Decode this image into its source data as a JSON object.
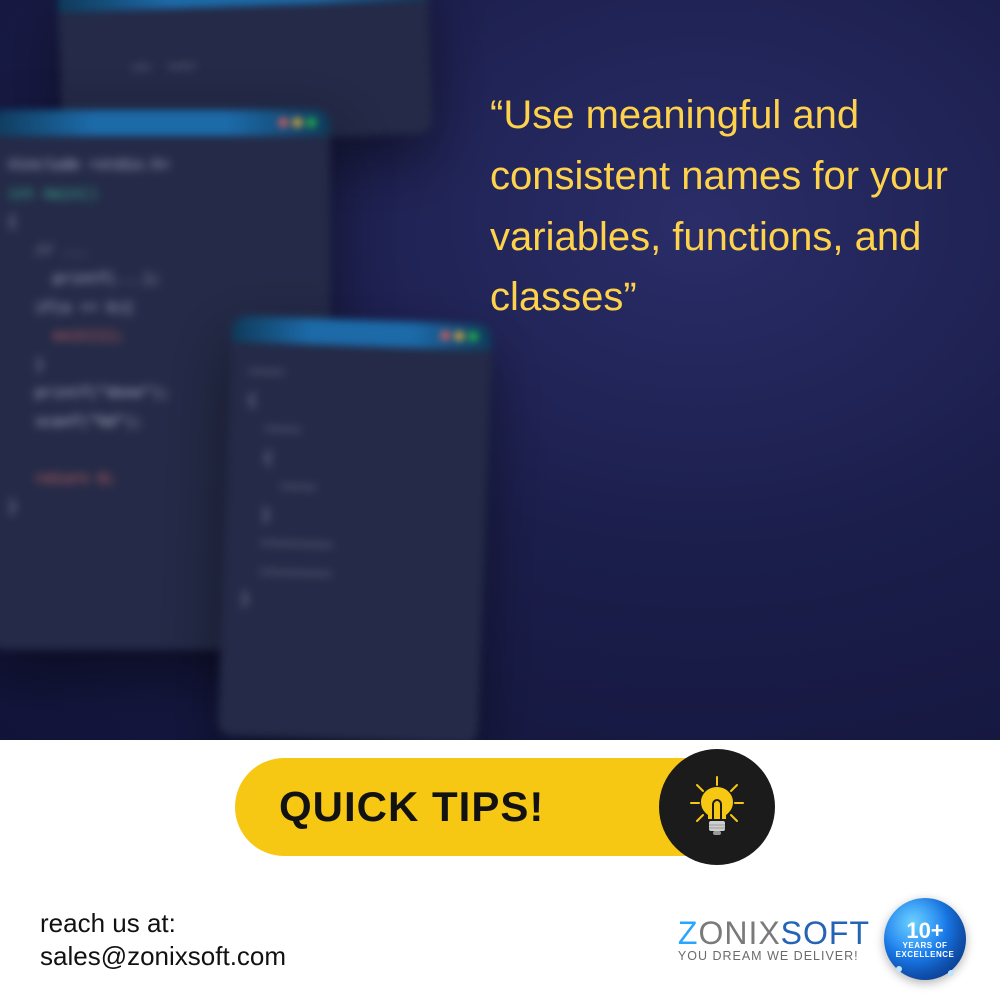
{
  "quote": "“Use meaningful and consistent names for your variables, functions, and classes”",
  "footer": {
    "pill_label": "QUICK TIPS!",
    "contact_label": "reach us at:",
    "contact_value": "sales@zonixsoft.com",
    "brand": {
      "pre": "Z",
      "mid": "ONIX",
      "post": "SOFT",
      "tag": "YOU DREAM WE DELIVER!"
    },
    "badge": {
      "big": "10+",
      "line1": "YEARS OF",
      "line2": "EXCELLENCE"
    }
  }
}
